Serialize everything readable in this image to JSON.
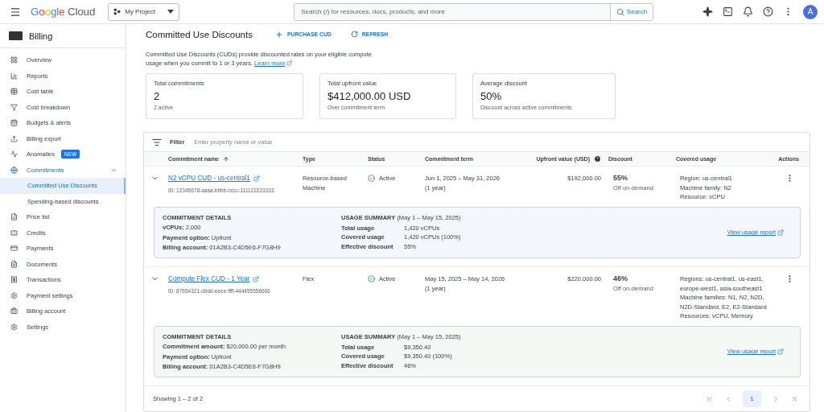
{
  "topbar": {
    "logo": {
      "brand": "Google",
      "product": "Cloud"
    },
    "project": "My Project",
    "search": {
      "placeholder": "Search (/) for resources, docs, products, and more",
      "button": "Search"
    },
    "avatar": "A"
  },
  "sidebar": {
    "title": "Billing",
    "items": [
      {
        "label": "Overview",
        "selected": false
      },
      {
        "label": "Reports",
        "selected": false
      },
      {
        "label": "Cost table",
        "selected": false
      },
      {
        "label": "Cost breakdown",
        "selected": false
      },
      {
        "label": "Budgets & alerts",
        "selected": false
      },
      {
        "label": "Billing export",
        "selected": false
      },
      {
        "label": "Anomalies",
        "badge": "NEW",
        "selected": false
      },
      {
        "label": "Commitments",
        "selected": false,
        "expanded": true,
        "children": [
          {
            "label": "Committed Use Discounts",
            "selected": true
          },
          {
            "label": "Spending-based discounts",
            "selected": false
          }
        ]
      },
      {
        "label": "Price list",
        "selected": false
      },
      {
        "label": "Credits",
        "selected": false
      },
      {
        "label": "Payments",
        "selected": false
      },
      {
        "label": "Documents",
        "selected": false
      },
      {
        "label": "Transactions",
        "selected": false
      },
      {
        "label": "Payment settings",
        "selected": false
      },
      {
        "label": "Billing account",
        "selected": false
      },
      {
        "label": "Settings",
        "selected": false
      }
    ]
  },
  "page": {
    "title": "Committed Use Discounts",
    "actions": [
      "PURCHASE CUD",
      "REFRESH"
    ],
    "intro": "Committed Use Discounts (CUDs) provide discounted rates on your eligible compute usage when you commit to 1 or 3 years.",
    "learn_more": "Learn more"
  },
  "summary_cards": [
    {
      "label": "Total commitments",
      "value": "2",
      "note": "2 active"
    },
    {
      "label": "Total upfront value",
      "value": "$412,000.00 USD",
      "note": "Over commitment term"
    },
    {
      "label": "Average discount",
      "value": "50%",
      "note": "Discount across active commitments"
    }
  ],
  "table": {
    "filter": {
      "label": "Filter",
      "placeholder": "Enter property name or value"
    },
    "columns": [
      {
        "label": "Commitment name",
        "sorted": true,
        "help": false
      },
      {
        "label": "Type",
        "sorted": false,
        "help": false
      },
      {
        "label": "Status",
        "sorted": false,
        "help": false
      },
      {
        "label": "Commitment term",
        "sorted": false,
        "help": false
      },
      {
        "label": "Upfront value (USD)",
        "sorted": false,
        "help": true
      },
      {
        "label": "Discount",
        "sorted": false,
        "help": false
      },
      {
        "label": "Covered usage",
        "sorted": false,
        "help": false
      },
      {
        "label": "Actions",
        "sorted": false,
        "help": false
      }
    ],
    "rows": [
      {
        "name": "N2 vCPU CUD - us-central1",
        "id": "ID: 12345678-aaaa-bbbb-cccc-111122223333",
        "type": "Resource-based Machine",
        "status": "Active",
        "term": "Jun 1, 2025 – May 31, 2026",
        "term_length": "(1 year)",
        "upfront": "$192,000.00",
        "discount": "55%",
        "discount_note": "Off on-demand",
        "covered": [
          "Region: us-central1",
          "Machine family: N2",
          "Resource: vCPU"
        ],
        "expanded": true,
        "details": {
          "color": "#c3d5f3",
          "heading": "COMMITMENT DETAILS",
          "lines": [
            "**vCPUs:** 2,000",
            "**Payment option:** Upfront",
            "**Billing account:** 01A2B3-C4D5E6-F7G8H9"
          ],
          "usage_heading": "**USAGE SUMMARY** (May 1 – May 15, 2025)",
          "usage": [
            {
              "label": "Total usage",
              "value": "1,420 vCPUs"
            },
            {
              "label": "Covered usage",
              "value": "1,420 vCPUs (100%)"
            },
            {
              "label": "Effective discount",
              "value": "55%"
            }
          ],
          "link": "View usage report"
        }
      },
      {
        "name": "Compute Flex CUD - 1 Year",
        "id": "ID: 87654321-dddd-eeee-ffff-444455556666",
        "type": "Flex",
        "status": "Active",
        "term": "May 15, 2025 – May 14, 2026",
        "term_length": "(1 year)",
        "upfront": "$220,000.00",
        "discount": "46%",
        "discount_note": "Off on-demand",
        "covered": [
          "Regions: us-central1, us-east1,",
          "europe-west1, asia-southeast1",
          "Machine families: N1, N2, N2D,",
          "N2D-Standard, E2, E2-Standard",
          "Resources: vCPU, Memory"
        ],
        "expanded": true,
        "details": {
          "color": "#c4e0c8",
          "heading": "COMMITMENT DETAILS",
          "lines": [
            "**Commitment amount:** $20,000.00 per month",
            "**Payment option:** Upfront",
            "**Billing account:** 01A2B3-C4D5E6-F7G8H9"
          ],
          "usage_heading": "**USAGE SUMMARY** (May 1 – May 15, 2025)",
          "usage": [
            {
              "label": "Total usage",
              "value": "$9,350.40"
            },
            {
              "label": "Covered usage",
              "value": "$9,350.40 (100%)"
            },
            {
              "label": "Effective discount",
              "value": "46%"
            }
          ],
          "link": "View usage report"
        }
      }
    ],
    "footer": {
      "showing": "Showing 1 – 2 of 2",
      "pages": [
        {
          "label": "1",
          "selected": true
        }
      ]
    }
  }
}
